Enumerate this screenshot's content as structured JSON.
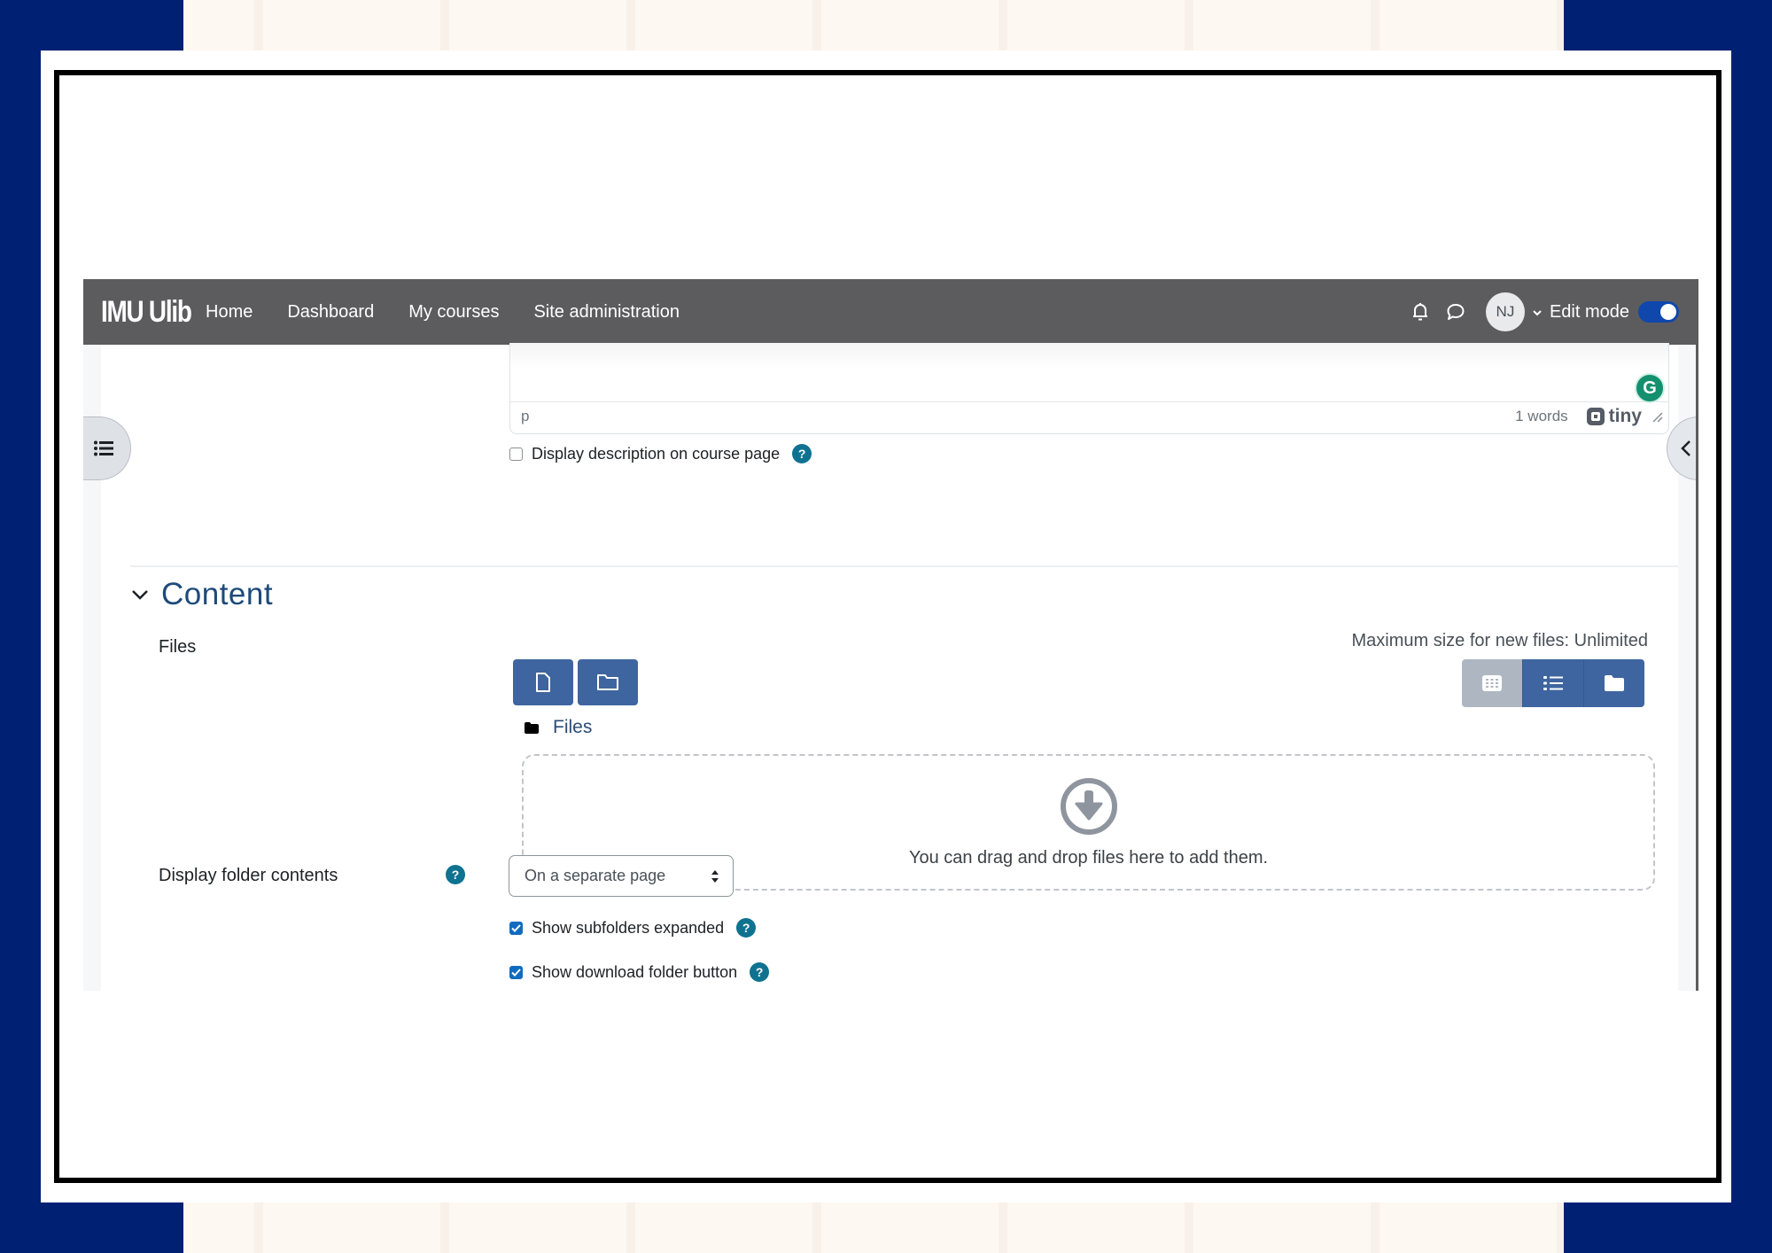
{
  "navbar": {
    "brand": "IMU Ulib",
    "items": [
      {
        "label": "Home"
      },
      {
        "label": "Dashboard"
      },
      {
        "label": "My courses"
      },
      {
        "label": "Site administration"
      }
    ],
    "avatar_initials": "NJ",
    "edit_mode_label": "Edit mode",
    "edit_mode_on": true,
    "icons": [
      "bell-icon",
      "chat-icon",
      "chevron-down-icon"
    ]
  },
  "editor": {
    "status_path": "p",
    "word_count": "1 words",
    "brand": "tiny",
    "grammarly_letter": "G"
  },
  "description_option": {
    "label": "Display description on course page",
    "checked": false,
    "help": "?"
  },
  "section": {
    "title": "Content",
    "expanded": true
  },
  "files_field": {
    "label": "Files",
    "max_size": "Maximum size for new files: Unlimited",
    "toolbar_buttons": [
      {
        "name": "add-file",
        "icon": "file-icon"
      },
      {
        "name": "create-folder",
        "icon": "folder-icon"
      }
    ],
    "view_buttons": [
      {
        "name": "view-icons",
        "icon": "grid-icon",
        "active": true
      },
      {
        "name": "view-details",
        "icon": "list-icon",
        "active": false
      },
      {
        "name": "view-tree",
        "icon": "folder-icon",
        "active": false
      }
    ],
    "path_label": "Files",
    "dropzone_text": "You can drag and drop files here to add them."
  },
  "display_folder": {
    "label": "Display folder contents",
    "help": "?",
    "selected": "On a separate page"
  },
  "checkbox_options": [
    {
      "label": "Show subfolders expanded",
      "checked": true,
      "help": "?"
    },
    {
      "label": "Show download folder button",
      "checked": true,
      "help": "?"
    }
  ],
  "colors": {
    "navbar_bg": "#5c5c5e",
    "primary_button": "#3e65a0",
    "help_icon": "#0f7290",
    "section_title": "#1e4a7a",
    "page_frame_bg": "#002074"
  }
}
